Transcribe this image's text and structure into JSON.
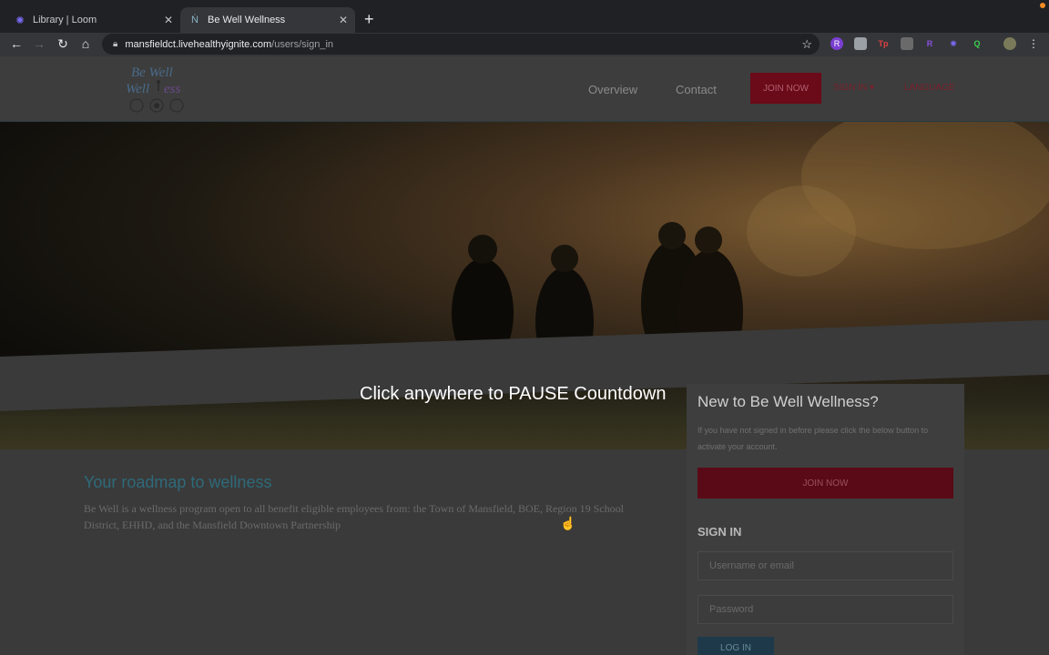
{
  "browser": {
    "tabs": [
      {
        "title": "Library | Loom",
        "favicon": "loom-icon"
      },
      {
        "title": "Be Well Wellness",
        "favicon": "site-icon"
      }
    ],
    "url_host": "mansfieldct.livehealthyignite.com",
    "url_path": "/users/sign_in"
  },
  "header": {
    "logo_text": "Be Well Wellness",
    "nav": {
      "overview": "Overview",
      "contact": "Contact"
    },
    "join_label": "JOIN NOW",
    "signin_label": "SIGN IN",
    "language_label": "LANGUAGE"
  },
  "hero": {
    "pause_message": "Click anywhere to PAUSE Countdown"
  },
  "card": {
    "title": "New to Be Well Wellness?",
    "description": "If you have not signed in before please click the below button to activate your account.",
    "join_label": "JOIN NOW",
    "signin_heading": "SIGN IN",
    "username_placeholder": "Username or email",
    "password_placeholder": "Password",
    "login_label": "LOG IN"
  },
  "main": {
    "roadmap_title": "Your roadmap to wellness",
    "roadmap_text": "Be Well is a wellness program open to all benefit eligible employees from: the Town of Mansfield, BOE, Region 19 School District, EHHD, and the Mansfield Downtown Partnership"
  },
  "colors": {
    "brand_red": "#6b0a18",
    "accent_teal": "#2e6a7a"
  }
}
